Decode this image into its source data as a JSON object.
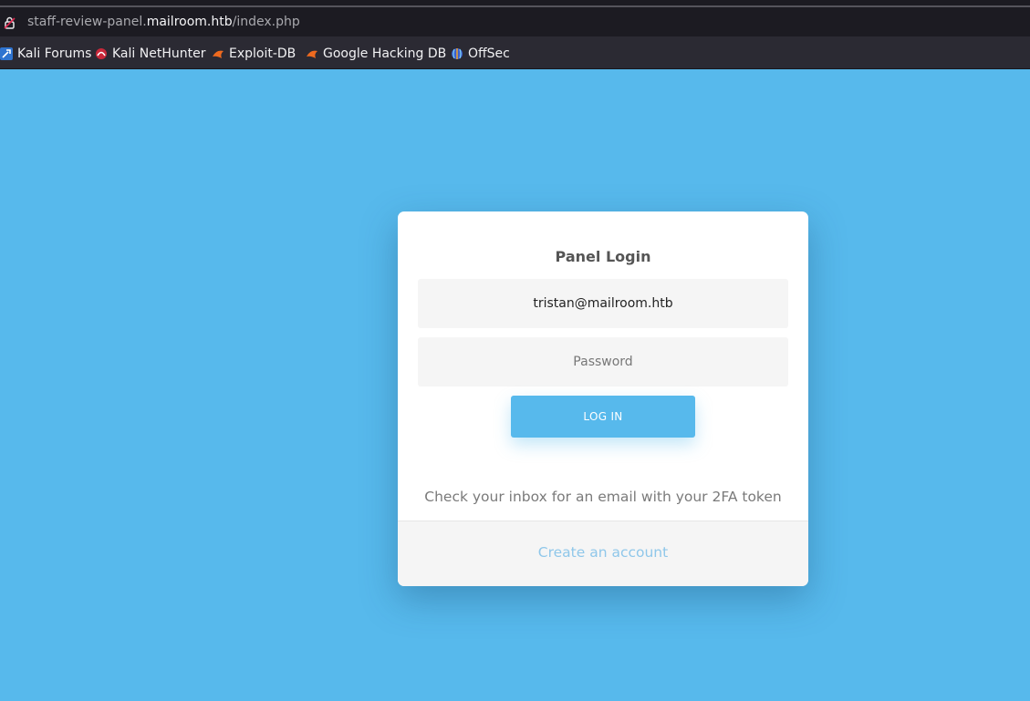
{
  "browser": {
    "url": {
      "prefix": "staff-review-panel.",
      "host": "mailroom.htb",
      "path": "/index.php"
    },
    "bookmarks": [
      {
        "label": "Kali Forums",
        "icon": "kali-forums-icon"
      },
      {
        "label": "Kali NetHunter",
        "icon": "kali-nethunter-icon"
      },
      {
        "label": "Exploit-DB",
        "icon": "exploit-db-icon"
      },
      {
        "label": "Google Hacking DB",
        "icon": "google-hacking-db-icon"
      },
      {
        "label": "OffSec",
        "icon": "offsec-icon"
      }
    ]
  },
  "login": {
    "title": "Panel Login",
    "email_value": "tristan@mailroom.htb",
    "password_placeholder": "Password",
    "button_label": "LOG IN",
    "message": "Check your inbox for an email with your 2FA token",
    "create_account_link": "Create an account"
  },
  "colors": {
    "page_background": "#57b9ec",
    "accent": "#57b9ec",
    "link": "#8fc7ea"
  }
}
